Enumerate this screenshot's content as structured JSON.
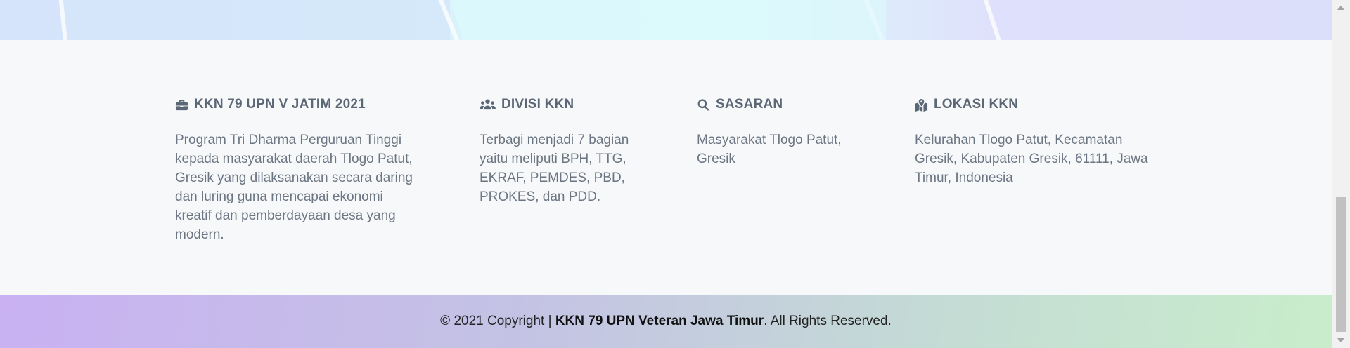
{
  "colors": {
    "heading": "#5c6776",
    "text": "#6c7582",
    "section_bg": "#f6f8fa",
    "copyright_gradient_start": "#c9b1f2",
    "copyright_gradient_end": "#c9edcb"
  },
  "footer": {
    "columns": [
      {
        "icon": "briefcase-icon",
        "title": "KKN 79 UPN V JATIM 2021",
        "lines": [
          "Program Tri Dharma Perguruan Tinggi",
          "kepada masyarakat daerah Tlogo Patut,",
          "Gresik yang dilaksanakan secara daring",
          "dan luring guna mencapai ekonomi",
          "kreatif dan pemberdayaan desa yang",
          "modern."
        ]
      },
      {
        "icon": "users-icon",
        "title": "DIVISI KKN",
        "lines": [
          "Terbagi menjadi 7 bagian",
          "yaitu meliputi BPH, TTG,",
          "EKRAF, PEMDES, PBD,",
          "PROKES, dan PDD."
        ]
      },
      {
        "icon": "search-icon",
        "title": "SASARAN",
        "lines": [
          "Masyarakat Tlogo Patut,",
          "Gresik"
        ]
      },
      {
        "icon": "map-marked-icon",
        "title": "LOKASI KKN",
        "lines": [
          "Kelurahan Tlogo Patut, Kecamatan",
          "Gresik, Kabupaten Gresik, 61111, Jawa",
          "Timur, Indonesia"
        ]
      }
    ]
  },
  "copyright": {
    "prefix": "© 2021 Copyright | ",
    "org": "KKN 79 UPN Veteran Jawa Timur",
    "suffix": ". All Rights Reserved."
  }
}
